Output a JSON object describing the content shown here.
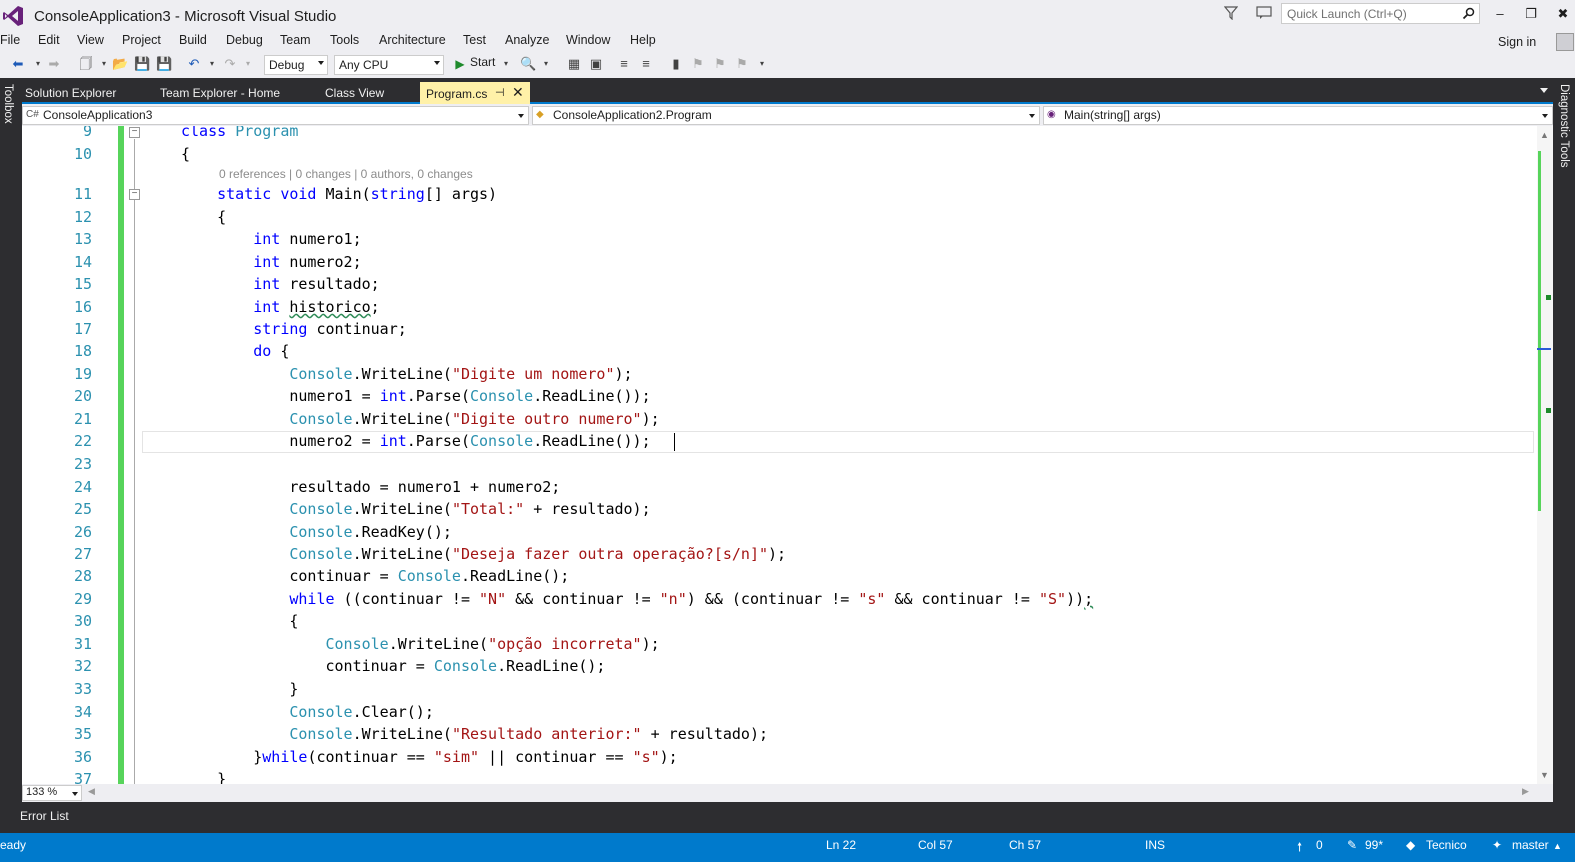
{
  "window": {
    "title": "ConsoleApplication3 - Microsoft Visual Studio",
    "quick_launch_placeholder": "Quick Launch (Ctrl+Q)",
    "sign_in": "Sign in",
    "minimize_glyph": "–",
    "maximize_glyph": "❐",
    "close_glyph": "✖"
  },
  "menu": [
    "File",
    "Edit",
    "View",
    "Project",
    "Build",
    "Debug",
    "Team",
    "Tools",
    "Architecture",
    "Test",
    "Analyze",
    "Window",
    "Help"
  ],
  "toolbar": {
    "configuration": "Debug",
    "platform": "Any CPU",
    "start_label": "Start"
  },
  "side_panels": {
    "left": "Toolbox",
    "right": "Diagnostic Tools"
  },
  "tabs": {
    "inactive": [
      "Solution Explorer",
      "Team Explorer - Home",
      "Class View"
    ],
    "active": "Program.cs"
  },
  "navigation": {
    "project": "ConsoleApplication3",
    "type": "ConsoleApplication2.Program",
    "member": "Main(string[] args)"
  },
  "editor": {
    "codelens": "0 references | 0 changes | 0 authors, 0 changes",
    "line_numbers": [
      "9",
      "10",
      "11",
      "12",
      "13",
      "14",
      "15",
      "16",
      "17",
      "18",
      "19",
      "20",
      "21",
      "22",
      "23",
      "24",
      "25",
      "26",
      "27",
      "28",
      "29",
      "30",
      "31",
      "32",
      "33",
      "34",
      "35",
      "36",
      "37"
    ],
    "zoom": "133 %"
  },
  "bottom_panel": {
    "error_list": "Error List"
  },
  "status": {
    "state": "eady",
    "line": "Ln 22",
    "column": "Col 57",
    "char": "Ch 57",
    "mode": "INS",
    "push_count": "0",
    "pending": "99*",
    "repository": "Tecnico",
    "branch": "master"
  },
  "colors": {
    "accent": "#007acc",
    "keyword": "#0000ff",
    "type": "#2b91af",
    "string": "#a31515",
    "active_tab": "#fff1a8",
    "change_margin": "#57d45b"
  }
}
